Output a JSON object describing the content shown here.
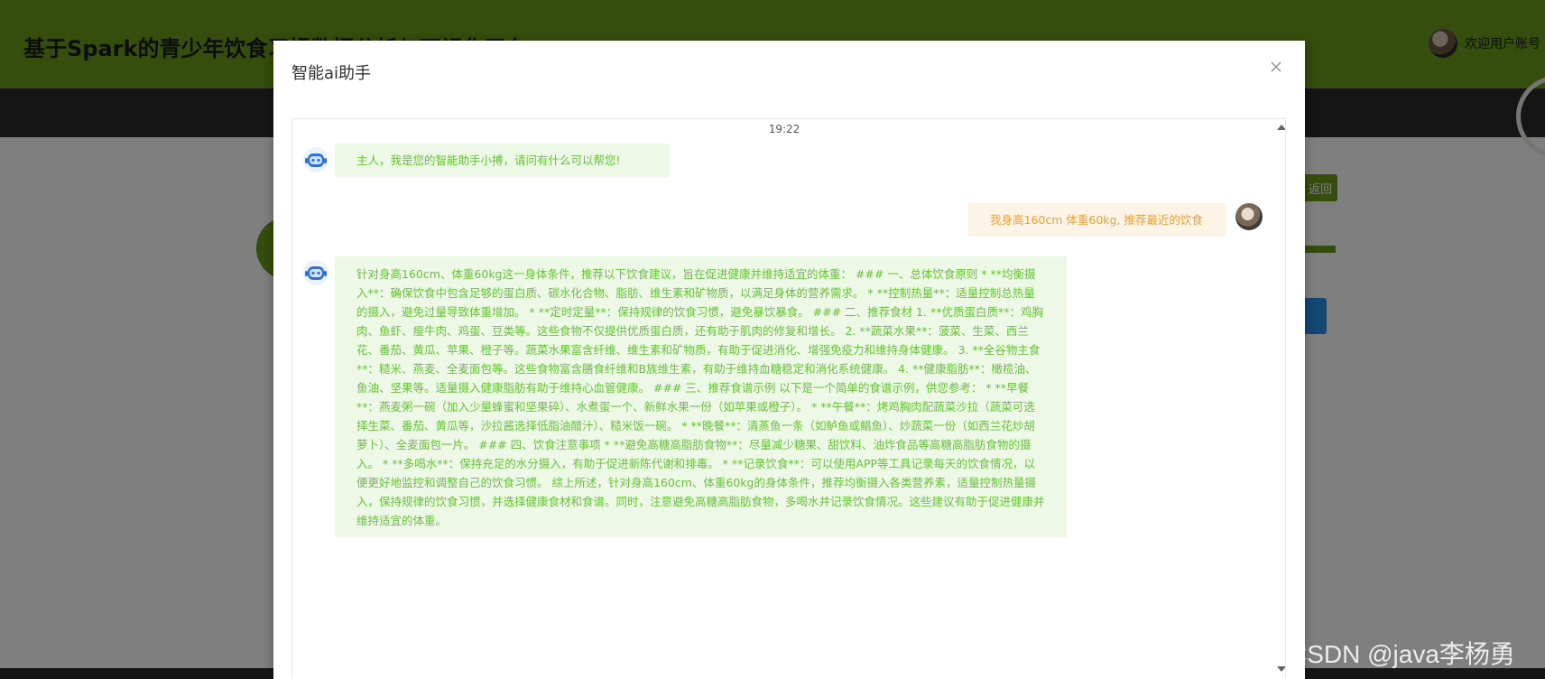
{
  "site": {
    "title": "基于Spark的青少年饮食习惯数据分析与可视化平台",
    "welcome": "欢迎用户账号",
    "back_button": "返回"
  },
  "dialog": {
    "title": "智能ai助手",
    "close_icon": "close-icon"
  },
  "chat": {
    "timestamp": "19:22",
    "messages": [
      {
        "role": "bot",
        "text": "主人，我是您的智能助手小搏，请问有什么可以帮您!"
      },
      {
        "role": "user",
        "text": "我身高160cm 体重60kg, 推荐最近的饮食"
      },
      {
        "role": "bot",
        "text": "针对身高160cm、体重60kg这一身体条件，推荐以下饮食建议，旨在促进健康并维持适宜的体重： ### 一、总体饮食原则 * **均衡摄入**：确保饮食中包含足够的蛋白质、碳水化合物、脂肪、维生素和矿物质，以满足身体的营养需求。 * **控制热量**：适量控制总热量的摄入，避免过量导致体重增加。 * **定时定量**：保持规律的饮食习惯，避免暴饮暴食。 ### 二、推荐食材 1. **优质蛋白质**：鸡胸肉、鱼虾、瘦牛肉、鸡蛋、豆类等。这些食物不仅提供优质蛋白质，还有助于肌肉的修复和增长。 2. **蔬菜水果**：菠菜、生菜、西兰花、番茄、黄瓜、苹果、橙子等。蔬菜水果富含纤维、维生素和矿物质，有助于促进消化、增强免疫力和维持身体健康。 3. **全谷物主食**：糙米、燕麦、全麦面包等。这些食物富含膳食纤维和B族维生素，有助于维持血糖稳定和消化系统健康。 4. **健康脂肪**：橄榄油、鱼油、坚果等。适量摄入健康脂肪有助于维持心血管健康。 ### 三、推荐食谱示例 以下是一个简单的食谱示例，供您参考： * **早餐**：燕麦粥一碗（加入少量蜂蜜和坚果碎）、水煮蛋一个、新鲜水果一份（如苹果或橙子）。 * **午餐**：烤鸡胸肉配蔬菜沙拉（蔬菜可选择生菜、番茄、黄瓜等，沙拉酱选择低脂油醋汁）、糙米饭一碗。 * **晚餐**：清蒸鱼一条（如鲈鱼或鲳鱼）、炒蔬菜一份（如西兰花炒胡萝卜）、全麦面包一片。 ### 四、饮食注意事项 * **避免高糖高脂肪食物**：尽量减少糖果、甜饮料、油炸食品等高糖高脂肪食物的摄入。 * **多喝水**：保持充足的水分摄入，有助于促进新陈代谢和排毒。 * **记录饮食**：可以使用APP等工具记录每天的饮食情况，以便更好地监控和调整自己的饮食习惯。 综上所述，针对身高160cm、体重60kg的身体条件，推荐均衡摄入各类营养素，适量控制热量摄入，保持规律的饮食习惯，并选择健康食材和食谱。同时，注意避免高糖高脂肪食物，多喝水并记录饮食情况。这些建议有助于促进健康并维持适宜的体重。"
      }
    ]
  },
  "watermark": "CSDN @java李杨勇",
  "colors": {
    "brand_green": "#6a9a1b",
    "bot_text": "#67c23a",
    "user_text": "#e6a23c"
  }
}
